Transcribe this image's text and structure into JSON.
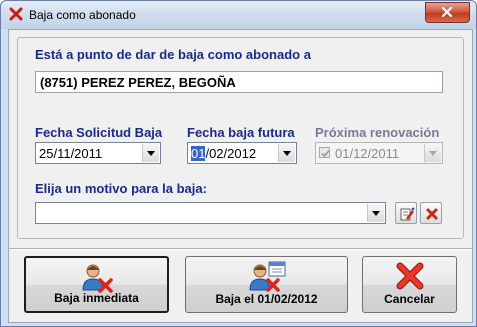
{
  "window": {
    "title": "Baja como abonado"
  },
  "form": {
    "intro_label": "Está a punto de dar de baja como abonado a",
    "member_name": "(8751) PEREZ PEREZ, BEGOÑA",
    "fecha_solicitud": {
      "label": "Fecha Solicitud Baja",
      "value": "25/11/2011"
    },
    "fecha_baja_futura": {
      "label": "Fecha baja futura",
      "value_selected": "01",
      "value_rest": "/02/2012"
    },
    "proxima_renovacion": {
      "label": "Próxima renovación",
      "value": "01/12/2011",
      "checked": true,
      "enabled": false
    },
    "motivo": {
      "label": "Elija un motivo para la baja:",
      "value": ""
    }
  },
  "buttons": {
    "baja_inmediata": "Baja inmediata",
    "baja_fecha": "Baja el 01/02/2012",
    "cancelar": "Cancelar"
  },
  "colors": {
    "label": "#1a2a8c",
    "label_disabled": "#7a7a96",
    "selection": "#3366cc",
    "cancel_x": "#d8261c"
  },
  "icons": {
    "title": "red-x-icon",
    "close": "close-icon",
    "edit_reason": "edit-list-icon",
    "clear_reason": "delete-x-icon",
    "baja_inmediata": "user-remove-icon",
    "baja_fecha": "user-calendar-remove-icon",
    "cancelar": "cancel-x-icon"
  }
}
